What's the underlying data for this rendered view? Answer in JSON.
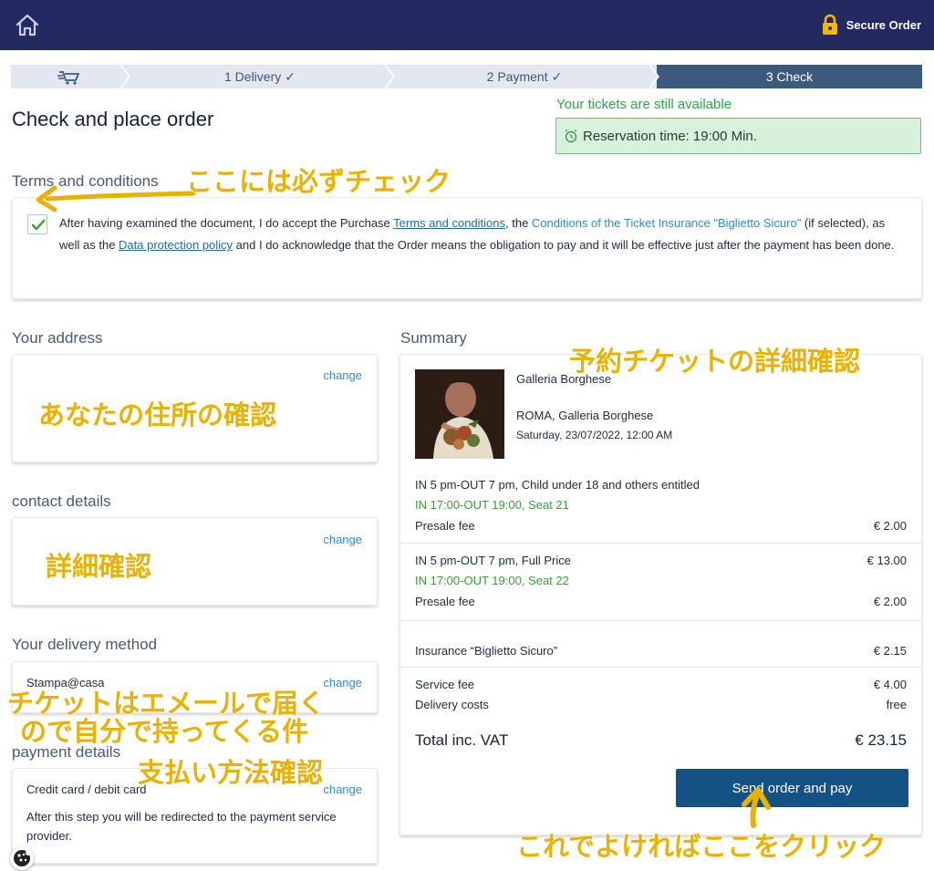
{
  "header": {
    "home_icon": "home-icon",
    "secure_label": "Secure Order",
    "lock_icon": "lock-icon",
    "lock_color": "#f5b800"
  },
  "stepper": {
    "cart_icon": "cart-icon",
    "steps": [
      {
        "label": "1 Delivery",
        "done": true
      },
      {
        "label": "2 Payment",
        "done": true
      },
      {
        "label": "3 Check",
        "active": true
      }
    ]
  },
  "page_title": "Check and place order",
  "reservation": {
    "availability": "Your tickets are still available",
    "time": "Reservation time: 19:00 Min."
  },
  "terms": {
    "heading": "Terms and conditions",
    "checked": true,
    "text_1": "After having examined the document, I do accept the Purchase ",
    "link_terms": "Terms and conditions",
    "text_2": ", the ",
    "link_insurance": "Conditions of the Ticket Insurance \"Biglietto Sicuro\"",
    "text_3": " (if selected), as well as the ",
    "link_privacy": "Data protection policy",
    "text_4": " and I do acknowledge that the Order means the obligation to pay and it will be effective just after the payment has been done."
  },
  "address": {
    "heading": "Your address",
    "change": "change"
  },
  "contact": {
    "heading": "contact details",
    "change": "change"
  },
  "delivery": {
    "heading": "Your delivery method",
    "method": "Stampa@casa",
    "change": "change"
  },
  "payment": {
    "heading": "payment details",
    "method": "Credit card / debit card",
    "change": "change",
    "note": "After this step you will be redirected to the payment service provider."
  },
  "summary": {
    "heading": "Summary",
    "venue": "Galleria Borghese",
    "location": "ROMA, Galleria Borghese",
    "datetime": "Saturday, 23/07/2022, 12:00 AM",
    "tickets": [
      {
        "name": "IN 5 pm-OUT 7 pm, Child under 18 and others entitled",
        "price": "",
        "slot": "IN 17:00-OUT 19:00, Seat 21",
        "fee_label": "Presale fee",
        "fee": "€ 2.00"
      },
      {
        "name": "IN 5 pm-OUT 7 pm, Full Price",
        "price": "€ 13.00",
        "slot": "IN 17:00-OUT 19:00, Seat 22",
        "fee_label": "Presale fee",
        "fee": "€ 2.00"
      }
    ],
    "insurance_label": "Insurance “Biglietto Sicuro”",
    "insurance": "€ 2.15",
    "service_label": "Service fee",
    "service": "€ 4.00",
    "delivery_label": "Delivery costs",
    "delivery": "free",
    "total_label": "Total inc. VAT",
    "total": "€ 23.15",
    "button": "Send order and pay"
  },
  "annotations": {
    "terms_note": "ここには必ずチェック",
    "address_note": "あなたの住所の確認",
    "contact_note": "詳細確認",
    "delivery_note_1": "チケットはエメールで届く",
    "delivery_note_2": "ので自分で持ってくる件",
    "payment_note": "支払い方法確認",
    "summary_note": "予約チケットの詳細確認",
    "button_note": "これでよければここをクリック",
    "color": "#e9b200"
  },
  "cookie_icon": "cookie-icon"
}
